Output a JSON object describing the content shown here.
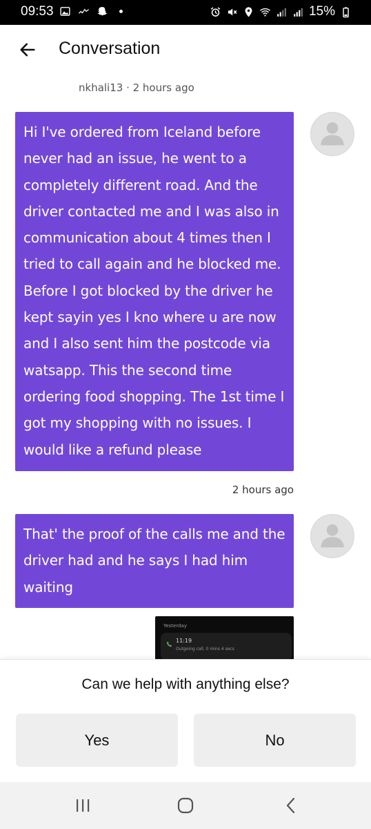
{
  "status_bar": {
    "time": "09:53",
    "battery": "15%",
    "left_icons": [
      "image-icon",
      "signal-activity-icon",
      "snapchat-icon",
      "dot-icon"
    ],
    "right_icons": [
      "alarm-icon",
      "mute-icon",
      "location-icon",
      "wifi-icon",
      "signal-icon",
      "signal-icon",
      "battery-icon"
    ]
  },
  "header": {
    "title": "Conversation",
    "back_icon": "arrow-left-icon"
  },
  "conversation": {
    "top_meta": "nkhali13 · 2 hours ago",
    "messages": [
      {
        "text": "Hi I've ordered from Iceland before never had an issue, he went to a completely different road. And the driver contacted me and I was also in communication about 4 times then I tried to call again and he blocked me. Before I got blocked by the driver he kept sayin yes I kno where u are now and I also sent him the postcode via watsapp. This the second time ordering food shopping. The 1st time I got my shopping with no issues. I would like a refund please",
        "time": "2 hours ago"
      },
      {
        "text": "That' the proof of the calls me and the driver had and he says I had him waiting"
      }
    ],
    "attachment": {
      "label": "Yesterday",
      "time": "11:19",
      "detail": "Outgoing call, 0 mins 4 secs"
    }
  },
  "help": {
    "question": "Can we help with anything else?",
    "yes_label": "Yes",
    "no_label": "No"
  },
  "colors": {
    "bubble": "#7247d8",
    "button_bg": "#eeeeee"
  }
}
